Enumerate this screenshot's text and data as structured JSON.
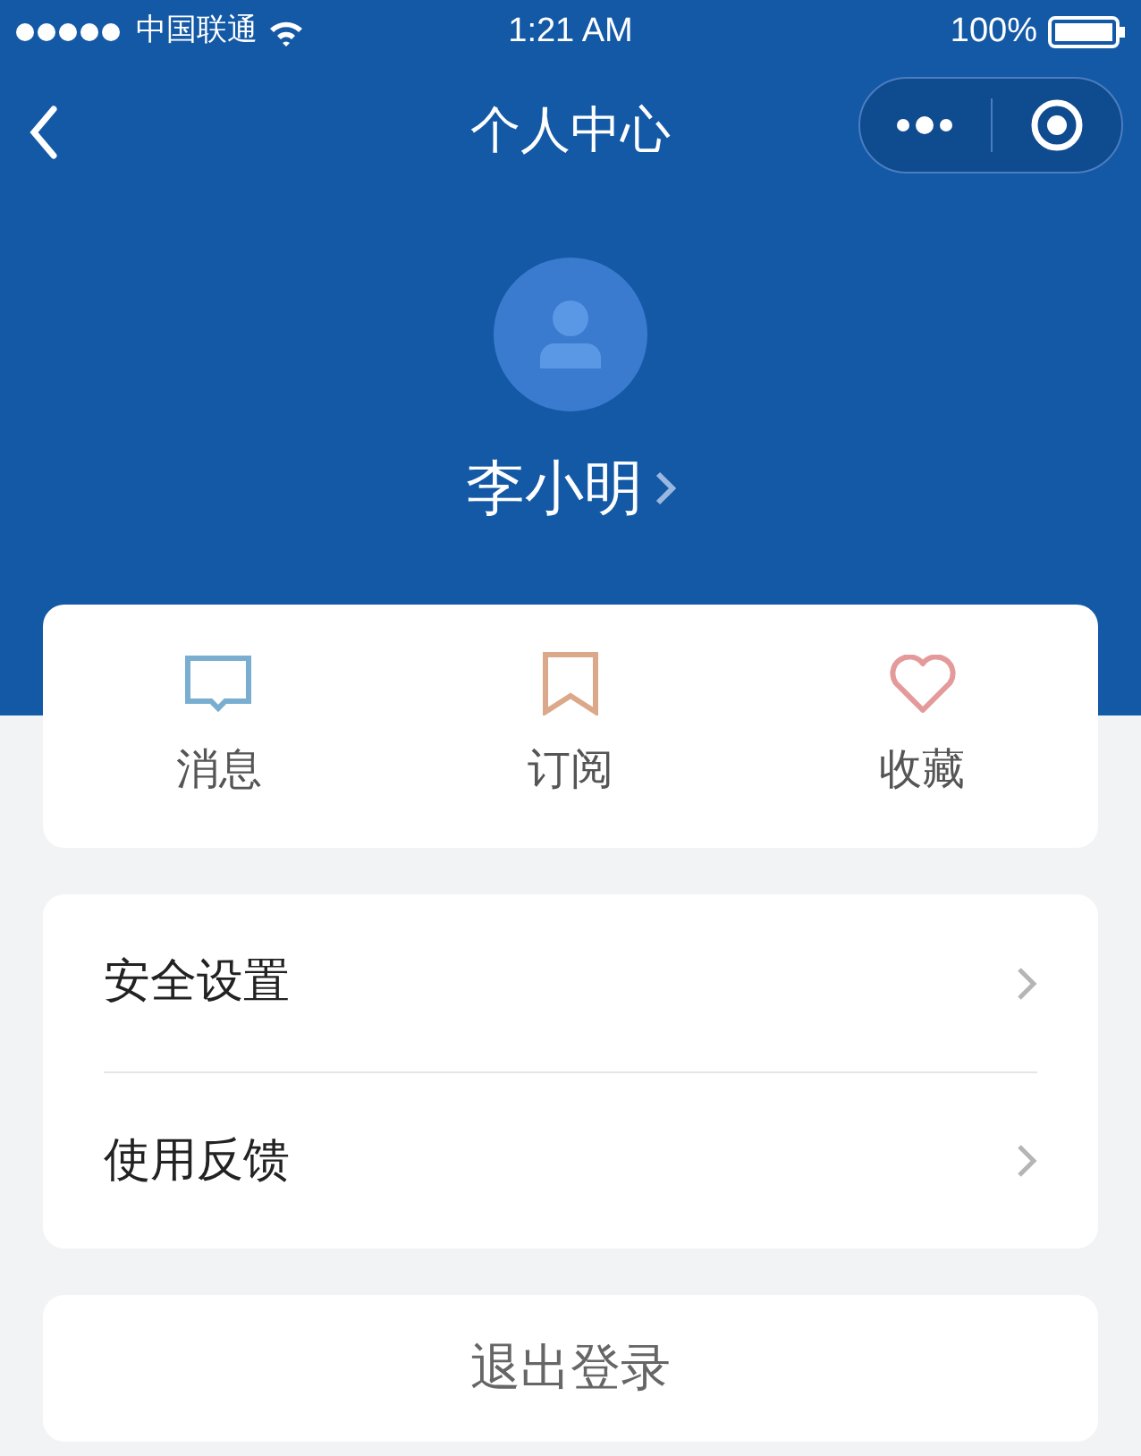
{
  "status_bar": {
    "carrier": "中国联通",
    "time": "1:21 AM",
    "battery": "100%"
  },
  "nav": {
    "title": "个人中心"
  },
  "profile": {
    "name": "李小明"
  },
  "quick_actions": [
    {
      "kind": "message",
      "label": "消息"
    },
    {
      "kind": "bookmark",
      "label": "订阅"
    },
    {
      "kind": "heart",
      "label": "收藏"
    }
  ],
  "menu": [
    {
      "label": "安全设置"
    },
    {
      "label": "使用反馈"
    }
  ],
  "logout": "退出登录"
}
